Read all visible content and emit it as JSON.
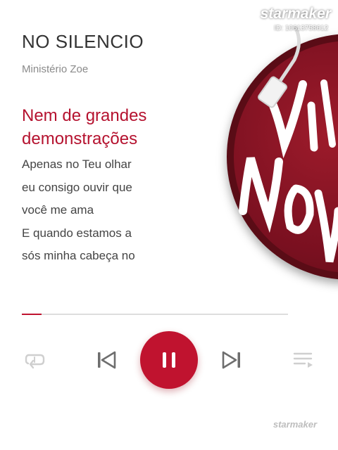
{
  "song": {
    "title": "NO SILENCIO",
    "artist": "Ministério Zoe"
  },
  "lyrics": {
    "current": [
      "Nem de grandes",
      "demonstrações"
    ],
    "upcoming": [
      "Apenas no Teu olhar",
      "eu consigo ouvir que",
      "você me ama",
      "E quando estamos a",
      "sós minha cabeça no"
    ]
  },
  "watermark": {
    "brand": "starmaker",
    "id_text": "ID: 10613758612"
  },
  "progress": {
    "fraction": 0.075
  },
  "controls": {
    "repeat": "repeat-icon",
    "previous": "skip-previous-icon",
    "pause": "pause-icon",
    "next": "skip-next-icon",
    "playlist": "playlist-icon"
  },
  "footer": {
    "brand": "starmaker"
  },
  "colors": {
    "accent": "#c0132f",
    "lyric_highlight": "#b5122f",
    "disc": "#7a1020",
    "inactive_icon": "#cfcfcf"
  }
}
